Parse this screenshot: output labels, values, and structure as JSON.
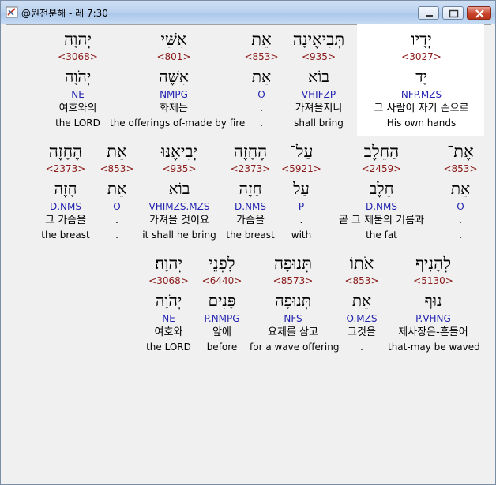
{
  "window": {
    "title": "@원전분해 - 레 7:30"
  },
  "rows": [
    {
      "words": [
        {
          "heb": "יְדָיו",
          "strong": "<3027>",
          "lemma": "יָד",
          "parse": "NFP.MZS",
          "kor": "그 사람이 자기 손으로",
          "eng": "His own hands",
          "highlighted": true
        },
        {
          "heb": "תְּבִיאֶינָה",
          "strong": "<935>",
          "lemma": "בוֹא",
          "parse": "VHIFZP",
          "kor": "가져올지니",
          "eng": "shall bring"
        },
        {
          "heb": "אֵת",
          "strong": "<853>",
          "lemma": "אֵת",
          "parse": "O",
          "kor": ".",
          "eng": "."
        },
        {
          "heb": "אִשֵּׁי",
          "strong": "<801>",
          "lemma": "אִשֶּׁה",
          "parse": "NMPG",
          "kor": "화제는",
          "eng": "the offerings of-made by fire"
        },
        {
          "heb": "יְהוָה",
          "strong": "<3068>",
          "lemma": "יְהֹוָה",
          "parse": "NE",
          "kor": "여호와의",
          "eng": "the LORD"
        }
      ]
    },
    {
      "words": [
        {
          "heb": "אֶת־",
          "strong": "<853>",
          "lemma": "אֵת",
          "parse": "O",
          "kor": ".",
          "eng": "."
        },
        {
          "heb": "הַחֵלֶב",
          "strong": "<2459>",
          "lemma": "חֵלֶב",
          "parse": "D.NMS",
          "kor": "곧 그 제물의 기름과",
          "eng": "the fat"
        },
        {
          "heb": "עַל־",
          "strong": "<5921>",
          "lemma": "עַל",
          "parse": "P",
          "kor": ".",
          "eng": "with"
        },
        {
          "heb": "הֶחָזֶה",
          "strong": "<2373>",
          "lemma": "חָזֶה",
          "parse": "D.NMS",
          "kor": "가슴을",
          "eng": "the breast"
        },
        {
          "heb": "יְבִיאֶנּוּ",
          "strong": "<935>",
          "lemma": "בוֹא",
          "parse": "VHIMZS.MZS",
          "kor": "가져올 것이요",
          "eng": "it shall he bring"
        },
        {
          "heb": "אֵת",
          "strong": "<853>",
          "lemma": "אֵת",
          "parse": "O",
          "kor": ".",
          "eng": "."
        },
        {
          "heb": "הֶחָזֶה",
          "strong": "<2373>",
          "lemma": "חָזֶה",
          "parse": "D.NMS",
          "kor": "그 가슴을",
          "eng": "the breast"
        }
      ]
    },
    {
      "words": [
        {
          "heb": "לְהָנִיף",
          "strong": "<5130>",
          "lemma": "נוּף",
          "parse": "P.VHNG",
          "kor": "제사장은-흔들어",
          "eng": "that-may be waved"
        },
        {
          "heb": "אֹתוֹ",
          "strong": "<853>",
          "lemma": "אֵת",
          "parse": "O.MZS",
          "kor": "그것을",
          "eng": "."
        },
        {
          "heb": "תְּנוּפָה",
          "strong": "<8573>",
          "lemma": "תְּנוּפָה",
          "parse": "NFS",
          "kor": "요제를 삼고",
          "eng": "for a wave offering"
        },
        {
          "heb": "לִפְנֵי",
          "strong": "<6440>",
          "lemma": "פָּנִים",
          "parse": "P.NMPG",
          "kor": "앞에",
          "eng": "before"
        },
        {
          "heb": "יְהוָה׃",
          "strong": "<3068>",
          "lemma": "יְהֹוָה",
          "parse": "NE",
          "kor": "여호와",
          "eng": "the LORD"
        }
      ]
    }
  ]
}
